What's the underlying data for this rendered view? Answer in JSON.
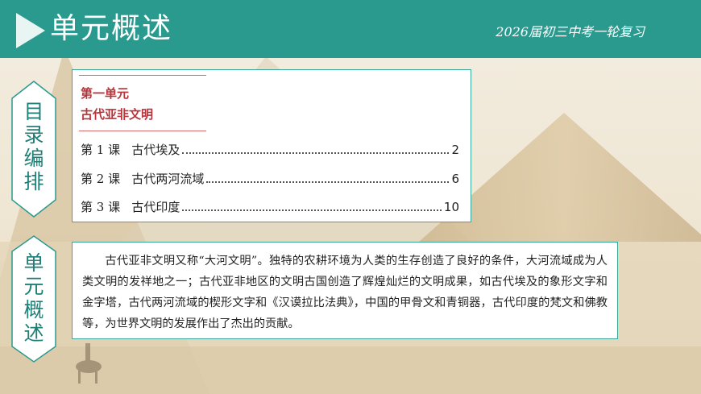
{
  "header": {
    "title": "单元概述",
    "subtitle": "2026届初三中考一轮复习"
  },
  "sidebar": {
    "toc_label": [
      "目",
      "录",
      "编",
      "排"
    ],
    "summary_label": [
      "单",
      "元",
      "概",
      "述"
    ]
  },
  "toc": {
    "unit_number": "第一单元",
    "unit_title": "古代亚非文明",
    "lessons": [
      {
        "label": "第 1 课   古代埃及",
        "page": "2"
      },
      {
        "label": "第 2 课   古代两河流域",
        "page": "6"
      },
      {
        "label": "第 3 课   古代印度",
        "page": "10"
      }
    ]
  },
  "summary": {
    "text": "古代亚非文明又称“大河文明”。独特的农耕环境为人类的生存创造了良好的条件，大河流域成为人类文明的发祥地之一；古代亚非地区的文明古国创造了辉煌灿烂的文明成果，如古代埃及的象形文字和金字塔，古代两河流域的楔形文字和《汉谟拉比法典》，中国的甲骨文和青铜器，古代印度的梵文和佛教等，为世界文明的发展作出了杰出的贡献。"
  },
  "colors": {
    "header_bg": "#2a9a8f",
    "accent": "#1f7f76",
    "unit_red": "#b8343a"
  }
}
